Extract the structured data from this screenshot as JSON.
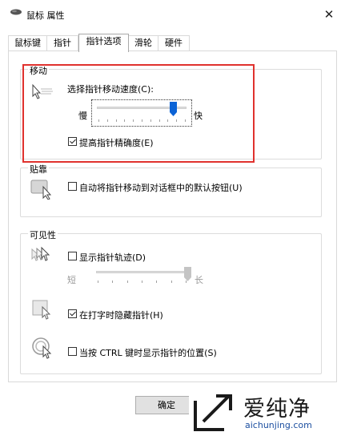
{
  "window": {
    "title": "鼠标 属性",
    "close_icon": "close-icon"
  },
  "tabs": [
    {
      "label": "鼠标键",
      "active": false
    },
    {
      "label": "指针",
      "active": false
    },
    {
      "label": "指针选项",
      "active": true
    },
    {
      "label": "滑轮",
      "active": false
    },
    {
      "label": "硬件",
      "active": false
    }
  ],
  "motion": {
    "group_label": "移动",
    "speed_label": "选择指针移动速度(C):",
    "slow_label": "慢",
    "fast_label": "快",
    "speed_level": 0.85,
    "precision_label": "提高指针精确度(E)",
    "precision_checked": true
  },
  "snap": {
    "group_label": "贴靠",
    "snap_label": "自动将指针移动到对话框中的默认按钮(U)",
    "snap_checked": false
  },
  "visibility": {
    "group_label": "可见性",
    "trails_label": "显示指针轨迹(D)",
    "trails_checked": false,
    "short_label": "短",
    "long_label": "长",
    "trail_level": 1.0,
    "hide_typing_label": "在打字时隐藏指针(H)",
    "hide_typing_checked": true,
    "ctrl_label": "当按 CTRL 键时显示指针的位置(S)",
    "ctrl_checked": false
  },
  "buttons": {
    "ok_label": "确定"
  },
  "watermark": {
    "title": "爱纯净",
    "url": "aichunjing.com"
  },
  "colors": {
    "highlight": "#e0322e",
    "accent": "#0b63d6"
  }
}
